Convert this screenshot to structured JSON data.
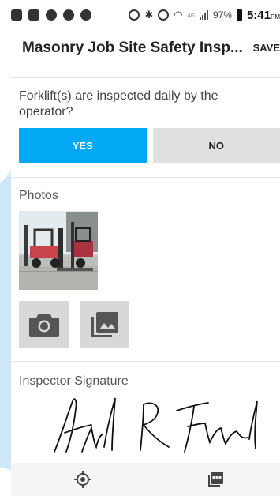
{
  "status_bar": {
    "battery_percent": "97%",
    "network_label": "4G",
    "time": "5:41",
    "time_suffix": "PM"
  },
  "app_bar": {
    "title": "Masonry Job Site Safety Insp...",
    "save_label": "SAVE"
  },
  "question": {
    "text": "Forklift(s) are inspected daily by the operator?",
    "yes_label": "YES",
    "no_label": "NO",
    "selected": "YES"
  },
  "photos": {
    "label": "Photos",
    "thumbnail_icon": "forklift-photo"
  },
  "actions": {
    "camera_icon": "camera-icon",
    "gallery_icon": "gallery-icon"
  },
  "signature": {
    "label": "Inspector Signature"
  },
  "bottom_nav": {
    "location_icon": "location-target-icon",
    "pdf_icon": "pdf-icon"
  },
  "colors": {
    "accent": "#03a9f4",
    "button_gray": "#e0e0e0",
    "action_gray": "#d8d8d8"
  }
}
